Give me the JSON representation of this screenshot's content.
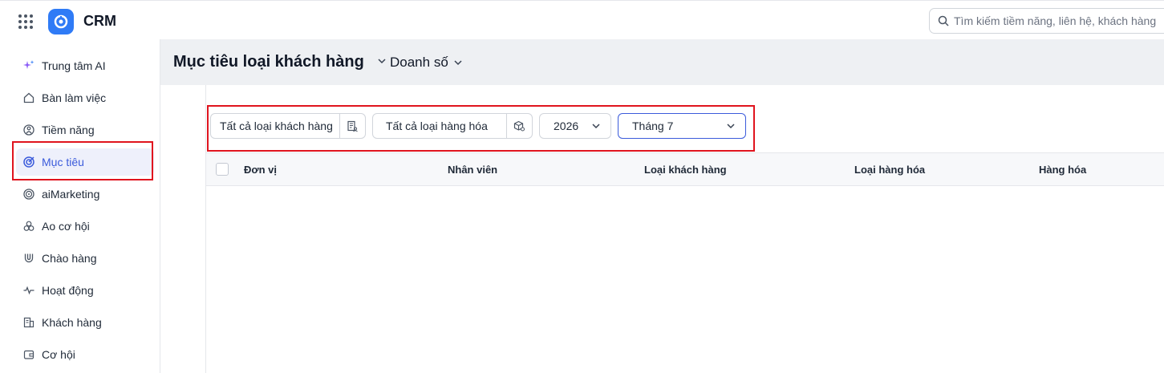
{
  "app": {
    "title": "CRM",
    "brand_color": "#2f7bf6"
  },
  "search": {
    "placeholder": "Tìm kiếm tiềm năng, liên hệ, khách hàng"
  },
  "sidebar": {
    "items": [
      {
        "label": "Trung tâm AI",
        "icon": "sparkle-icon"
      },
      {
        "label": "Bàn làm việc",
        "icon": "home-icon"
      },
      {
        "label": "Tiềm năng",
        "icon": "lead-icon"
      },
      {
        "label": "Mục tiêu",
        "icon": "target-icon",
        "active": true
      },
      {
        "label": "aiMarketing",
        "icon": "ai-marketing-icon"
      },
      {
        "label": "Ao cơ hội",
        "icon": "pool-icon"
      },
      {
        "label": "Chào hàng",
        "icon": "magnet-icon"
      },
      {
        "label": "Hoạt động",
        "icon": "pulse-icon"
      },
      {
        "label": "Khách hàng",
        "icon": "building-icon"
      },
      {
        "label": "Cơ hội",
        "icon": "wallet-icon"
      }
    ]
  },
  "header": {
    "title": "Mục tiêu loại khách hàng",
    "report_type": "Doanh số"
  },
  "filters": {
    "customer_type": "Tất cả loại khách hàng",
    "product_type": "Tất cả loại hàng hóa",
    "year": "2026",
    "month": "Tháng 7"
  },
  "table": {
    "columns": [
      "Đơn vị",
      "Nhân viên",
      "Loại khách hàng",
      "Loại hàng hóa",
      "Hàng hóa"
    ],
    "rows": []
  },
  "colors": {
    "highlight": "#e0141e",
    "active_nav_bg": "#eef0fb",
    "active_nav_text": "#3b5bdb"
  }
}
